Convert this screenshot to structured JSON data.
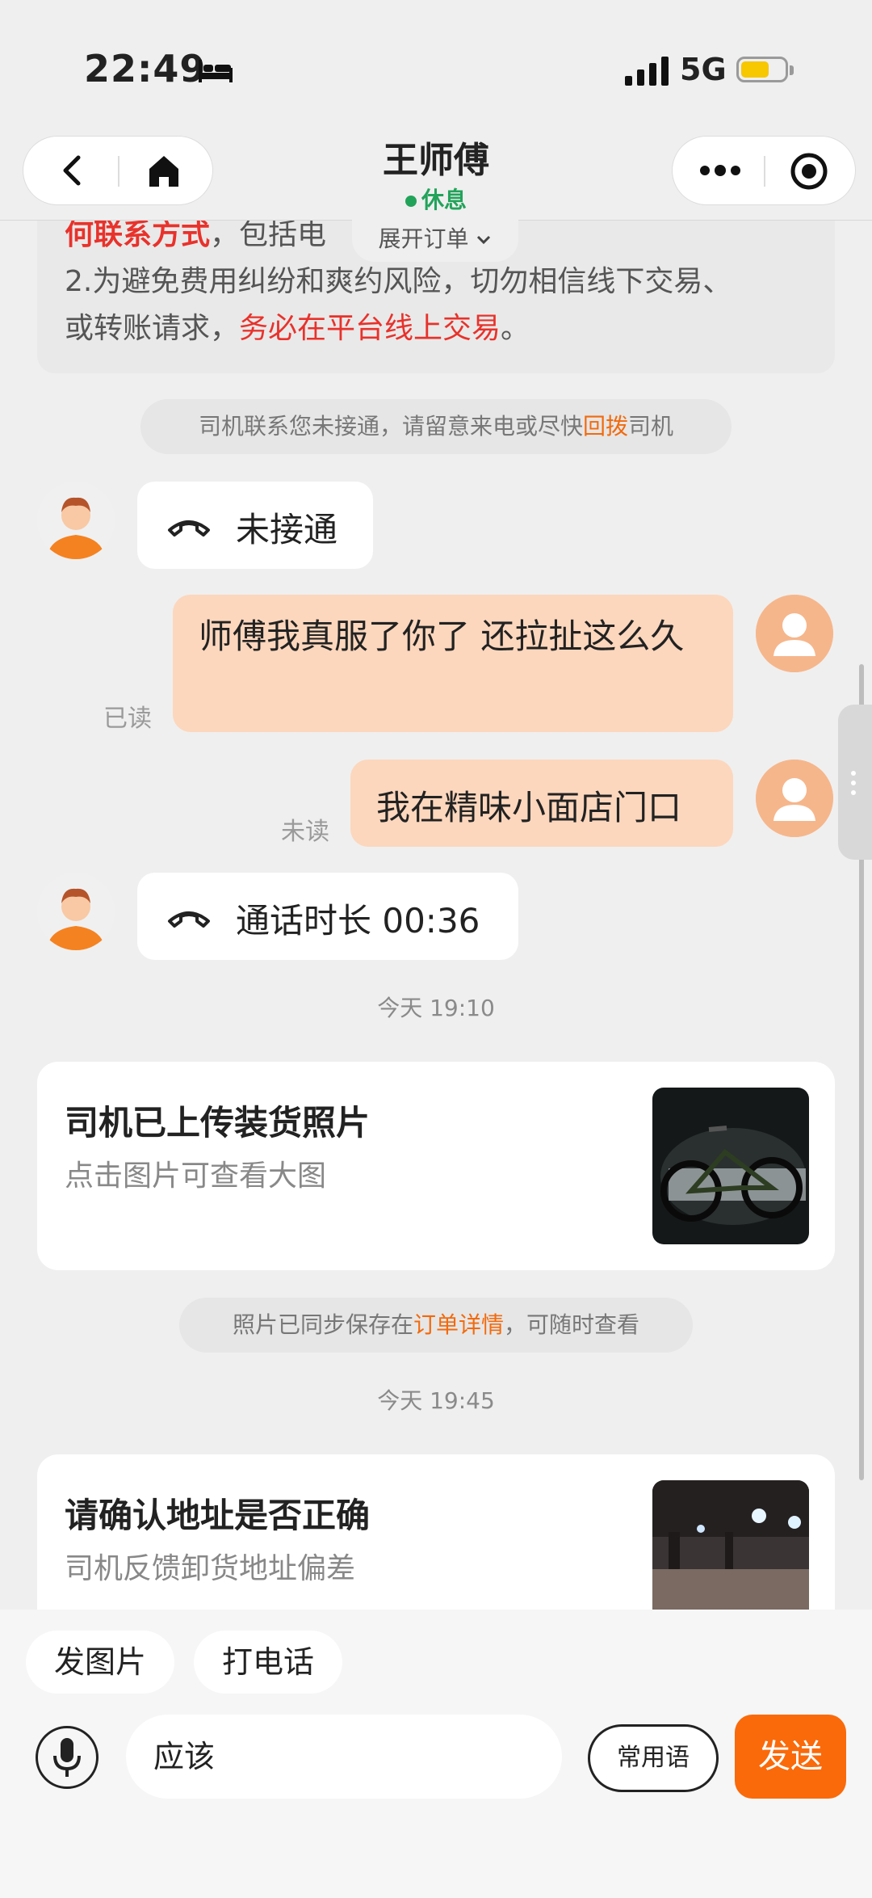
{
  "status_bar": {
    "time": "22:49",
    "network": "5G"
  },
  "header": {
    "title": "王师傅",
    "status": "休息",
    "expand_label": "展开订单"
  },
  "notice": {
    "line1_red": "何联系方式",
    "line1_rest": "，包括电",
    "line2": "2.为避免费用纠纷和爽约风险，切勿相信线下交易、",
    "line3_pre": "或转账请求，",
    "line3_red": "务必在平台线上交易",
    "line3_post": "。"
  },
  "messages": {
    "missed_note_pre": "司机联系您未接通，请留意来电或尽快",
    "missed_note_link": "回拨",
    "missed_note_post": "司机",
    "call_missed": "未接通",
    "msg1": "师傅我真服了你了 还拉扯这么久",
    "msg1_status": "已读",
    "msg2": "我在精味小面店门口",
    "msg2_status": "未读",
    "call_duration": "通话时长 00:36",
    "time1": "今天 19:10",
    "photo_card_title": "司机已上传装货照片",
    "photo_card_sub": "点击图片可查看大图",
    "photo_note_pre": "照片已同步保存在",
    "photo_note_link": "订单详情",
    "photo_note_post": "，可随时查看",
    "time2": "今天 19:45",
    "address_card_title": "请确认地址是否正确",
    "address_card_sub": "司机反馈卸货地址偏差"
  },
  "bottom": {
    "quick_photo": "发图片",
    "quick_call": "打电话",
    "input_value": "应该",
    "phrases_label": "常用语",
    "send_label": "发送"
  },
  "colors": {
    "accent": "#fa6a0a",
    "bubble_user": "#fcd7bd",
    "online_green": "#22a35a",
    "warning_red": "#e8322b"
  }
}
